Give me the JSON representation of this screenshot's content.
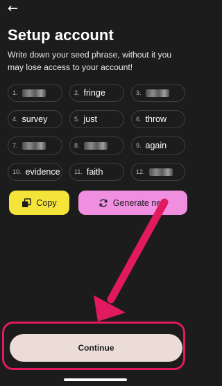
{
  "header": {
    "back_icon": "arrow-left-icon",
    "back_glyph": "←",
    "title": "Setup account",
    "subtitle": "Write down your seed phrase, without it you may lose access to your account!"
  },
  "seed": [
    {
      "num": "1.",
      "word": "",
      "hidden": true
    },
    {
      "num": "2.",
      "word": "fringe",
      "hidden": false
    },
    {
      "num": "3.",
      "word": "",
      "hidden": true
    },
    {
      "num": "4.",
      "word": "survey",
      "hidden": false
    },
    {
      "num": "5.",
      "word": "just",
      "hidden": false
    },
    {
      "num": "6.",
      "word": "throw",
      "hidden": false
    },
    {
      "num": "7.",
      "word": "",
      "hidden": true
    },
    {
      "num": "8.",
      "word": "",
      "hidden": true
    },
    {
      "num": "9.",
      "word": "again",
      "hidden": false
    },
    {
      "num": "10.",
      "word": "evidence",
      "hidden": false
    },
    {
      "num": "11.",
      "word": "faith",
      "hidden": false
    },
    {
      "num": "12.",
      "word": "",
      "hidden": true
    }
  ],
  "actions": {
    "copy_label": "Copy",
    "copy_icon": "copy-icon",
    "generate_label": "Generate new",
    "generate_icon": "refresh-icon"
  },
  "footer": {
    "continue_label": "Continue"
  },
  "colors": {
    "background": "#1c1c1c",
    "copy": "#f4e43a",
    "generate": "#f08fe0",
    "continue": "#ecdcd8",
    "annotation": "#e1195e"
  }
}
